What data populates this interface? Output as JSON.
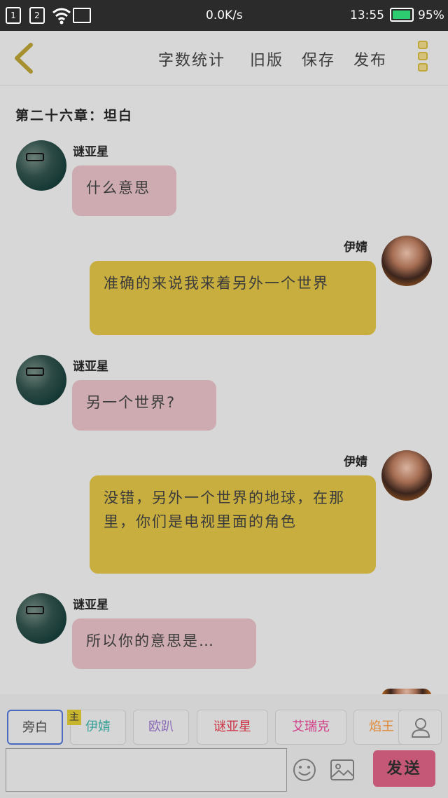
{
  "status_bar": {
    "sim1": "1",
    "sim2": "2",
    "net_speed": "0.0K/s",
    "time": "13:55",
    "battery": "95%"
  },
  "toolbar": {
    "word_count": "字数统计",
    "old_version": "旧版",
    "save": "保存",
    "publish": "发布"
  },
  "chapter_title": "第二十六章：坦白",
  "messages": [
    {
      "sender": "谜亚星",
      "text": "什么意思",
      "side": "left",
      "color": "#cdabb0"
    },
    {
      "sender": "伊婧",
      "text": "准确的来说我来着另外一个世界",
      "side": "right",
      "color": "#c7ae3f"
    },
    {
      "sender": "谜亚星",
      "text": "另一个世界?",
      "side": "left",
      "color": "#cdabb0"
    },
    {
      "sender": "伊婧",
      "text": "没错，另外一个世界的地球，在那里，你们是电视里面的角色",
      "side": "right",
      "color": "#c7ae3f"
    },
    {
      "sender": "谜亚星",
      "text": "所以你的意思是…",
      "side": "left",
      "color": "#cdabb0"
    },
    {
      "sender": "伊婧",
      "text": "",
      "side": "right",
      "color": "#c7ae3f"
    }
  ],
  "roles": [
    {
      "label": "旁白",
      "color": "#444444",
      "selected": true
    },
    {
      "label": "伊婧",
      "color": "#3aa39a",
      "selected": false
    },
    {
      "label": "欧趴",
      "color": "#8a6ab8",
      "selected": false
    },
    {
      "label": "谜亚星",
      "color": "#cc3344",
      "selected": false
    },
    {
      "label": "艾瑞克",
      "color": "#d03c86",
      "selected": false
    },
    {
      "label": "焰王",
      "color": "#e08a3a",
      "selected": false
    }
  ],
  "main_badge": "主",
  "input": {
    "value": "",
    "placeholder": ""
  },
  "send_label": "发送",
  "icons": {
    "back": "chevron-left-icon",
    "more": "more-vertical-icon",
    "contact": "person-icon",
    "emoji": "smiley-icon",
    "image": "image-icon"
  },
  "colors": {
    "accent_yellow": "#c7ae3f",
    "accent_pink": "#cdabb0",
    "send_button": "#c45876"
  }
}
